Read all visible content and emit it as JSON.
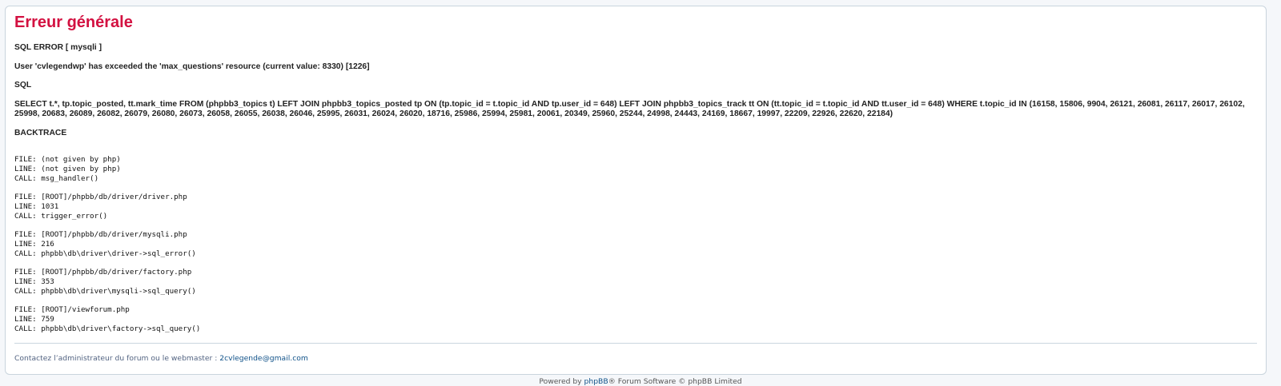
{
  "error": {
    "title": "Erreur générale",
    "kind": "SQL ERROR [ mysqli ]",
    "message": "User 'cvlegendwp' has exceeded the 'max_questions' resource (current value: 8330) [1226]",
    "sql_heading": "SQL",
    "sql": "SELECT t.*, tp.topic_posted, tt.mark_time FROM (phpbb3_topics t) LEFT JOIN phpbb3_topics_posted tp ON (tp.topic_id = t.topic_id AND tp.user_id = 648) LEFT JOIN phpbb3_topics_track tt ON (tt.topic_id = t.topic_id AND tt.user_id = 648) WHERE t.topic_id IN (16158, 15806, 9904, 26121, 26081, 26117, 26017, 26102, 25998, 20683, 26089, 26082, 26079, 26080, 26073, 26058, 26055, 26038, 26046, 25995, 26031, 26024, 26020, 18716, 25986, 25994, 25981, 20061, 20349, 25960, 25244, 24998, 24443, 24169, 18667, 19997, 22209, 22926, 22620, 22184)",
    "backtrace_heading": "BACKTRACE",
    "backtrace": [
      {
        "file": "FILE: (not given by php)",
        "line": "LINE: (not given by php)",
        "call": "CALL: msg_handler()"
      },
      {
        "file": "FILE: [ROOT]/phpbb/db/driver/driver.php",
        "line": "LINE: 1031",
        "call": "CALL: trigger_error()"
      },
      {
        "file": "FILE: [ROOT]/phpbb/db/driver/mysqli.php",
        "line": "LINE: 216",
        "call": "CALL: phpbb\\db\\driver\\driver->sql_error()"
      },
      {
        "file": "FILE: [ROOT]/phpbb/db/driver/factory.php",
        "line": "LINE: 353",
        "call": "CALL: phpbb\\db\\driver\\mysqli->sql_query()"
      },
      {
        "file": "FILE: [ROOT]/viewforum.php",
        "line": "LINE: 759",
        "call": "CALL: phpbb\\db\\driver\\factory->sql_query()"
      }
    ]
  },
  "contact": {
    "text": "Contactez l’administrateur du forum ou le webmaster : ",
    "email": "2cvlegende@gmail.com"
  },
  "footer": {
    "prefix": "Powered by ",
    "link": "phpBB",
    "suffix": "® Forum Software © phpBB Limited"
  }
}
